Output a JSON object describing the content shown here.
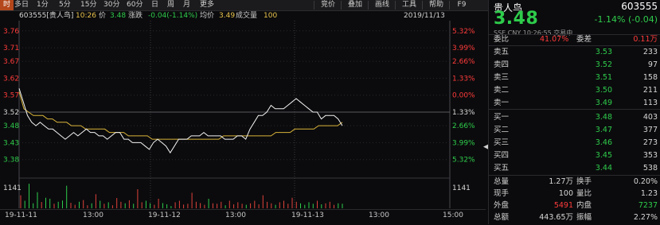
{
  "toolbar": {
    "tabs": [
      "时",
      "多日",
      "1分",
      "5分",
      "15分",
      "30分",
      "60分",
      "日",
      "周",
      "月",
      "更多"
    ],
    "tools": [
      "竞价",
      "叠加",
      "画线",
      "工具",
      "帮助",
      "F9"
    ]
  },
  "quote_bar": {
    "code_name": "603555[贵人鸟]",
    "time": "10:26",
    "price_label": "价",
    "price": "3.48",
    "change_label": "涨跌",
    "change": "-0.04(-1.14%)",
    "avg_label": "均价",
    "avg": "3.49",
    "volume_label": "成交量",
    "volume": "100",
    "date": "2019/11/13"
  },
  "x_labels": [
    "19-11-11",
    "13:00",
    "19-11-12",
    "13:00",
    "19-11-13",
    "13:00",
    "15:00"
  ],
  "volume_axis_label": "1141",
  "chart_data": {
    "type": "line",
    "title": "",
    "ylim": [
      3.33,
      3.79
    ],
    "y_ticks_left": [
      "3.76",
      "3.71",
      "3.67",
      "3.62",
      "3.57",
      "3.52",
      "3.48",
      "3.43",
      "3.38"
    ],
    "y_ticks_right": [
      "5.32%",
      "3.99%",
      "2.66%",
      "1.33%",
      "0.00%",
      "1.33%",
      "2.66%",
      "3.99%",
      "5.32%"
    ],
    "prev_close": 3.52,
    "x_labels": [
      "19-11-11",
      "13:00",
      "19-11-12",
      "13:00",
      "19-11-13",
      "13:00",
      "15:00"
    ],
    "series": [
      {
        "values": [
          3.59,
          3.55,
          3.51,
          3.49,
          3.48,
          3.49,
          3.48,
          3.47,
          3.47,
          3.46,
          3.45,
          3.44,
          3.45,
          3.46,
          3.45,
          3.46,
          3.47,
          3.46,
          3.46,
          3.45,
          3.45,
          3.44,
          3.45,
          3.46,
          3.46,
          3.44,
          3.44,
          3.43,
          3.43,
          3.43,
          3.42,
          3.41,
          3.43,
          3.44,
          3.43,
          3.42,
          3.4,
          3.42,
          3.44,
          3.44,
          3.44,
          3.45,
          3.45,
          3.45,
          3.46,
          3.45,
          3.45,
          3.45,
          3.45,
          3.44,
          3.44,
          3.44,
          3.45,
          3.45,
          3.44,
          3.47,
          3.49,
          3.51,
          3.51,
          3.52,
          3.54,
          3.53,
          3.53,
          3.53,
          3.54,
          3.55,
          3.56,
          3.55,
          3.54,
          3.53,
          3.52,
          3.52,
          3.5,
          3.51,
          3.51,
          3.51,
          3.5,
          3.48
        ]
      },
      {
        "values": [
          3.58,
          3.53,
          3.52,
          3.51,
          3.51,
          3.51,
          3.5,
          3.5,
          3.49,
          3.49,
          3.49,
          3.48,
          3.48,
          3.48,
          3.47,
          3.47,
          3.47,
          3.47,
          3.47,
          3.46,
          3.46,
          3.46,
          3.46,
          3.45,
          3.45,
          3.45,
          3.45,
          3.45,
          3.44,
          3.44,
          3.44,
          3.44,
          3.44,
          3.44,
          3.44,
          3.44,
          3.44,
          3.44,
          3.44,
          3.44,
          3.44,
          3.44,
          3.44,
          3.45,
          3.45,
          3.45,
          3.45,
          3.45,
          3.45,
          3.45,
          3.45,
          3.45,
          3.45,
          3.45,
          3.46,
          3.46,
          3.46,
          3.46,
          3.47,
          3.47,
          3.47,
          3.47,
          3.47,
          3.48,
          3.48,
          3.48,
          3.48,
          3.48,
          3.49
        ]
      }
    ],
    "volume_max": 1141,
    "volumes": [
      520,
      300,
      980,
      200,
      640,
      250,
      420,
      380,
      180,
      260,
      310,
      900,
      220,
      140,
      260,
      330,
      120,
      200,
      560,
      300,
      180,
      240,
      120,
      410,
      260,
      200,
      320,
      180,
      760,
      240,
      300,
      200,
      140,
      380,
      210,
      160,
      90,
      240,
      300,
      150,
      180,
      620,
      260,
      210,
      140,
      380,
      200,
      180,
      260,
      120,
      300,
      160,
      240,
      180,
      140,
      200,
      300,
      160,
      520,
      260,
      200,
      140,
      240,
      300,
      180,
      420,
      260,
      200,
      140,
      240,
      180,
      300,
      160,
      200,
      260,
      140,
      200,
      180
    ]
  },
  "right_panel": {
    "name": "贵人鸟",
    "code": "603555",
    "price": "3.48",
    "change": "-1.14% (-0.04)",
    "info": "SSE  CNY  10:26:55  交易中",
    "ratio_label": "委比",
    "ratio_value": "41.07%",
    "diff_label": "委差",
    "diff_value": "0.11万",
    "asks": [
      {
        "label": "卖五",
        "price": "3.53",
        "vol": "233"
      },
      {
        "label": "卖四",
        "price": "3.52",
        "vol": "97"
      },
      {
        "label": "卖三",
        "price": "3.51",
        "vol": "158"
      },
      {
        "label": "卖二",
        "price": "3.50",
        "vol": "211"
      },
      {
        "label": "卖一",
        "price": "3.49",
        "vol": "113"
      }
    ],
    "bids": [
      {
        "label": "买一",
        "price": "3.48",
        "vol": "403"
      },
      {
        "label": "买二",
        "price": "3.47",
        "vol": "377"
      },
      {
        "label": "买三",
        "price": "3.46",
        "vol": "273"
      },
      {
        "label": "买四",
        "price": "3.45",
        "vol": "353"
      },
      {
        "label": "买五",
        "price": "3.44",
        "vol": "538"
      }
    ],
    "stats": [
      {
        "l1": "总量",
        "v1": "1.27万",
        "l2": "换手",
        "v2": "0.20%"
      },
      {
        "l1": "现手",
        "v1": "100",
        "l2": "量比",
        "v2": "1.23"
      },
      {
        "l1": "外盘",
        "v1": "5491",
        "l2": "内盘",
        "v2": "7237"
      },
      {
        "l1": "总额",
        "v1": "443.65万",
        "l2": "振幅",
        "v2": "2.27%"
      }
    ],
    "colors": {
      "up": "#ff3b3b",
      "down": "#2ecc4b",
      "flat": "#d7d7d7"
    }
  }
}
